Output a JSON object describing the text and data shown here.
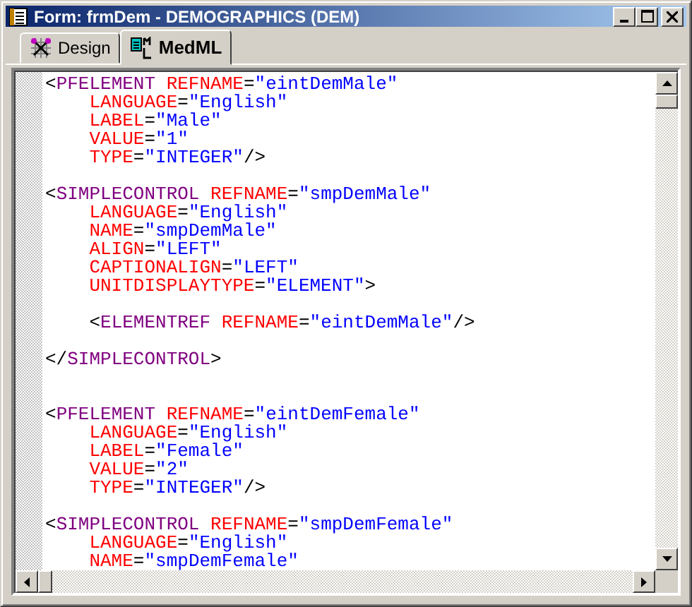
{
  "window": {
    "title": "Form: frmDem - DEMOGRAPHICS (DEM)"
  },
  "tabs": [
    {
      "label": "Design",
      "selected": false
    },
    {
      "label": "MedML",
      "selected": true
    }
  ],
  "editor": {
    "lines": [
      {
        "kind": "code",
        "tokens": [
          {
            "kind": "punct",
            "text": "<"
          },
          {
            "kind": "tag",
            "text": "PFELEMENT"
          },
          {
            "kind": "attr",
            "text": " REFNAME"
          },
          {
            "kind": "punct",
            "text": "="
          },
          {
            "kind": "value",
            "text": "\"eintDemMale\""
          }
        ]
      },
      {
        "kind": "code",
        "tokens": [
          {
            "kind": "attr",
            "text": "    LANGUAGE"
          },
          {
            "kind": "punct",
            "text": "="
          },
          {
            "kind": "value",
            "text": "\"English\""
          }
        ]
      },
      {
        "kind": "code",
        "tokens": [
          {
            "kind": "attr",
            "text": "    LABEL"
          },
          {
            "kind": "punct",
            "text": "="
          },
          {
            "kind": "value",
            "text": "\"Male\""
          }
        ]
      },
      {
        "kind": "code",
        "tokens": [
          {
            "kind": "attr",
            "text": "    VALUE"
          },
          {
            "kind": "punct",
            "text": "="
          },
          {
            "kind": "value",
            "text": "\"1\""
          }
        ]
      },
      {
        "kind": "code",
        "tokens": [
          {
            "kind": "attr",
            "text": "    TYPE"
          },
          {
            "kind": "punct",
            "text": "="
          },
          {
            "kind": "value",
            "text": "\"INTEGER\""
          },
          {
            "kind": "punct",
            "text": "/>"
          }
        ]
      },
      {
        "kind": "blank"
      },
      {
        "kind": "code",
        "tokens": [
          {
            "kind": "punct",
            "text": "<"
          },
          {
            "kind": "tag",
            "text": "SIMPLECONTROL"
          },
          {
            "kind": "attr",
            "text": " REFNAME"
          },
          {
            "kind": "punct",
            "text": "="
          },
          {
            "kind": "value",
            "text": "\"smpDemMale\""
          }
        ]
      },
      {
        "kind": "code",
        "tokens": [
          {
            "kind": "attr",
            "text": "    LANGUAGE"
          },
          {
            "kind": "punct",
            "text": "="
          },
          {
            "kind": "value",
            "text": "\"English\""
          }
        ]
      },
      {
        "kind": "code",
        "tokens": [
          {
            "kind": "attr",
            "text": "    NAME"
          },
          {
            "kind": "punct",
            "text": "="
          },
          {
            "kind": "value",
            "text": "\"smpDemMale\""
          }
        ]
      },
      {
        "kind": "code",
        "tokens": [
          {
            "kind": "attr",
            "text": "    ALIGN"
          },
          {
            "kind": "punct",
            "text": "="
          },
          {
            "kind": "value",
            "text": "\"LEFT\""
          }
        ]
      },
      {
        "kind": "code",
        "tokens": [
          {
            "kind": "attr",
            "text": "    CAPTIONALIGN"
          },
          {
            "kind": "punct",
            "text": "="
          },
          {
            "kind": "value",
            "text": "\"LEFT\""
          }
        ]
      },
      {
        "kind": "code",
        "tokens": [
          {
            "kind": "attr",
            "text": "    UNITDISPLAYTYPE"
          },
          {
            "kind": "punct",
            "text": "="
          },
          {
            "kind": "value",
            "text": "\"ELEMENT\""
          },
          {
            "kind": "punct",
            "text": ">"
          }
        ]
      },
      {
        "kind": "blank"
      },
      {
        "kind": "code",
        "tokens": [
          {
            "kind": "punct",
            "text": "    <"
          },
          {
            "kind": "tag",
            "text": "ELEMENTREF"
          },
          {
            "kind": "attr",
            "text": " REFNAME"
          },
          {
            "kind": "punct",
            "text": "="
          },
          {
            "kind": "value",
            "text": "\"eintDemMale\""
          },
          {
            "kind": "punct",
            "text": "/>"
          }
        ]
      },
      {
        "kind": "blank"
      },
      {
        "kind": "code",
        "tokens": [
          {
            "kind": "punct",
            "text": "</"
          },
          {
            "kind": "tag",
            "text": "SIMPLECONTROL"
          },
          {
            "kind": "punct",
            "text": ">"
          }
        ]
      },
      {
        "kind": "blank"
      },
      {
        "kind": "blank"
      },
      {
        "kind": "code",
        "tokens": [
          {
            "kind": "punct",
            "text": "<"
          },
          {
            "kind": "tag",
            "text": "PFELEMENT"
          },
          {
            "kind": "attr",
            "text": " REFNAME"
          },
          {
            "kind": "punct",
            "text": "="
          },
          {
            "kind": "value",
            "text": "\"eintDemFemale\""
          }
        ]
      },
      {
        "kind": "code",
        "tokens": [
          {
            "kind": "attr",
            "text": "    LANGUAGE"
          },
          {
            "kind": "punct",
            "text": "="
          },
          {
            "kind": "value",
            "text": "\"English\""
          }
        ]
      },
      {
        "kind": "code",
        "tokens": [
          {
            "kind": "attr",
            "text": "    LABEL"
          },
          {
            "kind": "punct",
            "text": "="
          },
          {
            "kind": "value",
            "text": "\"Female\""
          }
        ]
      },
      {
        "kind": "code",
        "tokens": [
          {
            "kind": "attr",
            "text": "    VALUE"
          },
          {
            "kind": "punct",
            "text": "="
          },
          {
            "kind": "value",
            "text": "\"2\""
          }
        ]
      },
      {
        "kind": "code",
        "tokens": [
          {
            "kind": "attr",
            "text": "    TYPE"
          },
          {
            "kind": "punct",
            "text": "="
          },
          {
            "kind": "value",
            "text": "\"INTEGER\""
          },
          {
            "kind": "punct",
            "text": "/>"
          }
        ]
      },
      {
        "kind": "blank"
      },
      {
        "kind": "code",
        "tokens": [
          {
            "kind": "punct",
            "text": "<"
          },
          {
            "kind": "tag",
            "text": "SIMPLECONTROL"
          },
          {
            "kind": "attr",
            "text": " REFNAME"
          },
          {
            "kind": "punct",
            "text": "="
          },
          {
            "kind": "value",
            "text": "\"smpDemFemale\""
          }
        ]
      },
      {
        "kind": "code",
        "tokens": [
          {
            "kind": "attr",
            "text": "    LANGUAGE"
          },
          {
            "kind": "punct",
            "text": "="
          },
          {
            "kind": "value",
            "text": "\"English\""
          }
        ]
      },
      {
        "kind": "code",
        "tokens": [
          {
            "kind": "attr",
            "text": "    NAME"
          },
          {
            "kind": "punct",
            "text": "="
          },
          {
            "kind": "value",
            "text": "\"smpDemFemale\""
          }
        ]
      }
    ]
  }
}
